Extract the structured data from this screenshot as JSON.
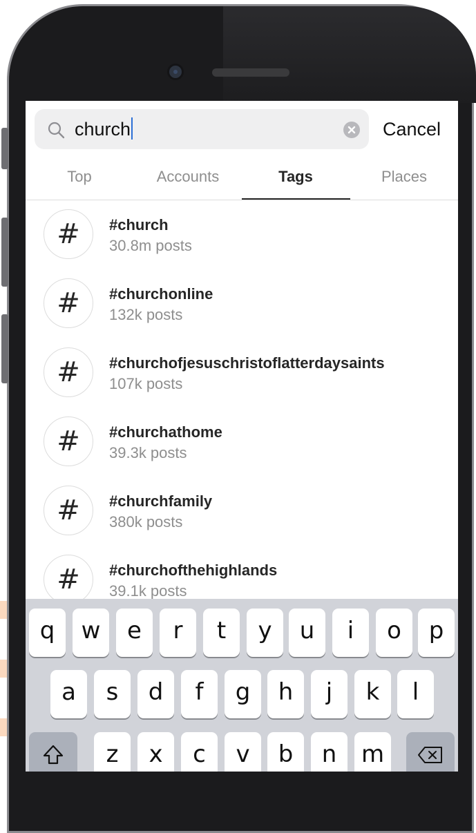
{
  "search": {
    "query": "church",
    "cancel_label": "Cancel"
  },
  "tabs": [
    {
      "label": "Top",
      "active": false
    },
    {
      "label": "Accounts",
      "active": false
    },
    {
      "label": "Tags",
      "active": true
    },
    {
      "label": "Places",
      "active": false
    }
  ],
  "results": [
    {
      "name": "#church",
      "count": "30.8m posts"
    },
    {
      "name": "#churchonline",
      "count": "132k posts"
    },
    {
      "name": "#churchofjesuschristoflatterdaysaints",
      "count": "107k posts"
    },
    {
      "name": "#churchathome",
      "count": "39.3k posts"
    },
    {
      "name": "#churchfamily",
      "count": "380k posts"
    },
    {
      "name": "#churchofthehighlands",
      "count": "39.1k posts"
    }
  ],
  "hash_symbol": "#",
  "keyboard": {
    "row1": [
      "q",
      "w",
      "e",
      "r",
      "t",
      "y",
      "u",
      "i",
      "o",
      "p"
    ],
    "row2": [
      "a",
      "s",
      "d",
      "f",
      "g",
      "h",
      "j",
      "k",
      "l"
    ],
    "row3": [
      "z",
      "x",
      "c",
      "v",
      "b",
      "n",
      "m"
    ],
    "shift_icon": "shift-arrow-icon",
    "delete_icon": "backspace-icon"
  },
  "colors": {
    "active_tab": "#262626",
    "inactive_tab": "#8e8e8e",
    "caret": "#2b6fd6",
    "keyboard_bg": "#d1d3d9"
  }
}
